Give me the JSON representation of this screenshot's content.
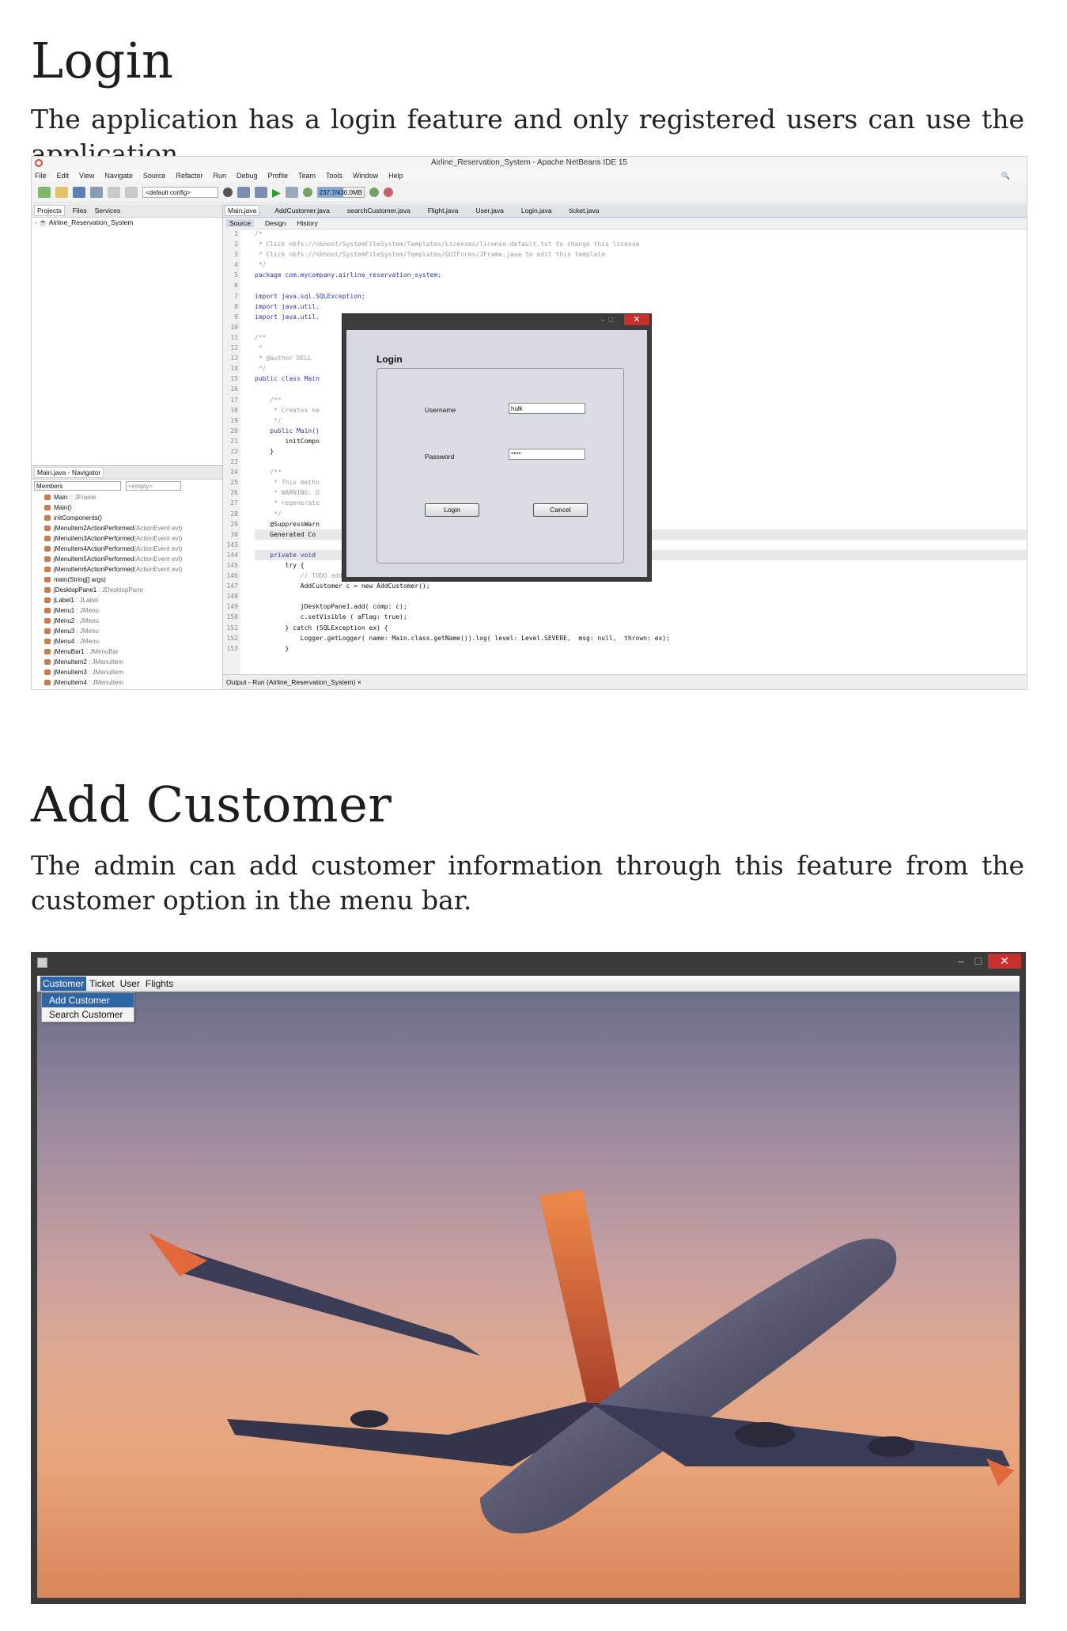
{
  "sections": [
    {
      "heading": "Login",
      "text": "The application has a login feature and only registered users can use the application."
    },
    {
      "heading": "Add Customer",
      "text": "The admin can add customer information through this feature from the customer option in the menu bar."
    }
  ],
  "ide": {
    "window_title": "Airline_Reservation_System - Apache NetBeans IDE 15",
    "menu": [
      "File",
      "Edit",
      "View",
      "Navigate",
      "Source",
      "Refactor",
      "Run",
      "Debug",
      "Profile",
      "Team",
      "Tools",
      "Window",
      "Help"
    ],
    "config_select": "<default config>",
    "memory_label": "237.7/430.0MB",
    "memory_fraction": 0.55,
    "left_tabs": [
      "Projects",
      "Files",
      "Services"
    ],
    "project_name": "Airline_Reservation_System",
    "navigator_title": "Main.java - Navigator",
    "navigator_members": "Members",
    "navigator_filter": "<empty>",
    "navigator_items": [
      {
        "name": "Main",
        "type": " :: JFrame"
      },
      {
        "name": "Main()",
        "type": ""
      },
      {
        "name": "initComponents()",
        "type": ""
      },
      {
        "name": "jMenuItem2ActionPerformed",
        "type": "(ActionEvent evt)"
      },
      {
        "name": "jMenuItem3ActionPerformed",
        "type": "(ActionEvent evt)"
      },
      {
        "name": "jMenuItem4ActionPerformed",
        "type": "(ActionEvent evt)"
      },
      {
        "name": "jMenuItem5ActionPerformed",
        "type": "(ActionEvent evt)"
      },
      {
        "name": "jMenuItem6ActionPerformed",
        "type": "(ActionEvent evt)"
      },
      {
        "name": "main(String[] args)",
        "type": ""
      },
      {
        "name": "jDesktopPane1",
        "type": " : JDesktopPane"
      },
      {
        "name": "jLabel1",
        "type": " : JLabel"
      },
      {
        "name": "jMenu1",
        "type": " : JMenu"
      },
      {
        "name": "jMenu2",
        "type": " : JMenu"
      },
      {
        "name": "jMenu3",
        "type": " : JMenu"
      },
      {
        "name": "jMenu4",
        "type": " : JMenu"
      },
      {
        "name": "jMenuBar1",
        "type": " : JMenuBar"
      },
      {
        "name": "jMenuItem2",
        "type": " : JMenuItem"
      },
      {
        "name": "jMenuItem3",
        "type": " : JMenuItem"
      },
      {
        "name": "jMenuItem4",
        "type": " : JMenuItem"
      }
    ],
    "editor_tabs": [
      "Main.java",
      "AddCustomer.java",
      "searchCustomer.java",
      "Flight.java",
      "User.java",
      "Login.java",
      "ticket.java"
    ],
    "editor_subtabs": [
      "Source",
      "Design",
      "History"
    ],
    "line_numbers": [
      "1",
      "2",
      "3",
      "4",
      "5",
      "6",
      "7",
      "8",
      "9",
      "10",
      "11",
      "12",
      "13",
      "14",
      "15",
      "16",
      "17",
      "18",
      "19",
      "20",
      "21",
      "22",
      "23",
      "24",
      "25",
      "26",
      "27",
      "28",
      "29",
      "30",
      "143",
      "144",
      "145",
      "146",
      "147",
      "148",
      "149",
      "150",
      "151",
      "152",
      "153"
    ],
    "code_lines": [
      "/*",
      " * Click nbfs://nbhost/SystemFileSystem/Templates/Licenses/license-default.txt to change this license",
      " * Click nbfs://nbhost/SystemFileSystem/Templates/GUIForms/JFrame.java to edit this template",
      " */",
      "package com.mycompany.airline_reservation_system;",
      "",
      "import java.sql.SQLException;",
      "import java.util.",
      "import java.util.",
      "",
      "/**",
      " *",
      " * @author DELL",
      " */",
      "public class Main",
      "",
      "    /**",
      "     * Creates ne",
      "     */",
      "    public Main()",
      "        initCompo",
      "    }",
      "",
      "    /**",
      "     * This metho",
      "     * WARNING: D",
      "     * regenerate",
      "     */",
      "    @SuppressWarn",
      "    Generated Co",
      "",
      "    private void",
      "        try {",
      "            // TODO add your handling code here:",
      "            AddCustomer c = new AddCustomer();",
      "",
      "            jDesktopPane1.add( comp: c);",
      "            c.setVisible ( aFlag: true);",
      "        } catch (SQLException ex) {",
      "            Logger.getLogger( name: Main.class.getName()).log( level: Level.SEVERE,  msg: null,  thrown: ex);",
      "        }"
    ],
    "output_label": "Output - Run (Airline_Reservation_System)",
    "login_dialog": {
      "title": "Login",
      "username_label": "Username",
      "username_value": "hulk",
      "password_label": "Password",
      "password_value": "****",
      "login_button": "Login",
      "cancel_button": "Cancel"
    }
  },
  "app": {
    "menu": [
      "Customer",
      "Ticket",
      "User",
      "Flights"
    ],
    "dropdown": [
      "Add Customer",
      "Search Customer"
    ]
  }
}
